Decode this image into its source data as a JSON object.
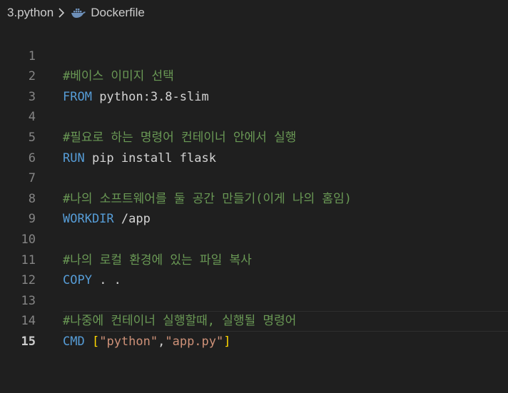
{
  "breadcrumb": {
    "folder": "3.python",
    "file": "Dockerfile",
    "file_icon": "docker-whale-icon"
  },
  "colors": {
    "background": "#1f1f1f",
    "line_number": "#858585",
    "active_line_number": "#cccccc",
    "comment": "#6a9955",
    "keyword": "#569cd6",
    "string": "#ce9178",
    "bracket": "#ffd700",
    "text": "#d4d4d4"
  },
  "editor": {
    "current_line": 15,
    "lines": [
      {
        "n": "1",
        "comment": "#베이스 이미지 선택"
      },
      {
        "n": "2",
        "kw": "FROM",
        "rest": " python:3.8-slim"
      },
      {
        "n": "3"
      },
      {
        "n": "4",
        "comment": "#필요로 하는 명령어 컨테이너 안에서 실행"
      },
      {
        "n": "5",
        "kw": "RUN",
        "rest": " pip install flask"
      },
      {
        "n": "6"
      },
      {
        "n": "7",
        "comment": "#나의 소프트웨어를 둘 공간 만들기(이게 나의 홈임)"
      },
      {
        "n": "8",
        "kw": "WORKDIR",
        "rest": " /app"
      },
      {
        "n": "9"
      },
      {
        "n": "10",
        "comment": "#나의 로컬 환경에 있는 파일 복사"
      },
      {
        "n": "11",
        "kw": "COPY",
        "rest": " . ."
      },
      {
        "n": "12"
      },
      {
        "n": "13",
        "comment": "#나중에 컨테이너 실행할때, 실행될 명령어"
      },
      {
        "n": "14",
        "kw": "CMD",
        "sp": " ",
        "ob": "[",
        "s1": "\"python\"",
        "comma": ",",
        "s2": "\"app.py\"",
        "cb": "]"
      },
      {
        "n": "15"
      }
    ]
  }
}
